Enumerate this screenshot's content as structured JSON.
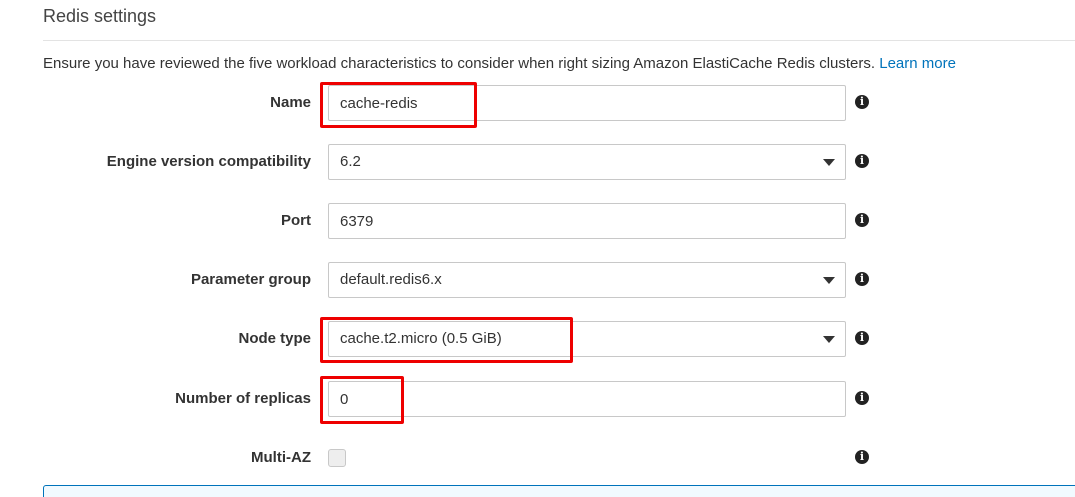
{
  "section": {
    "title": "Redis settings",
    "intro": "Ensure you have reviewed the five workload characteristics to consider when right sizing Amazon ElastiCache Redis clusters.",
    "learn_more": "Learn more"
  },
  "fields": {
    "name": {
      "label": "Name",
      "value": "cache-redis"
    },
    "engine_version": {
      "label": "Engine version compatibility",
      "value": "6.2"
    },
    "port": {
      "label": "Port",
      "value": "6379"
    },
    "parameter_group": {
      "label": "Parameter group",
      "value": "default.redis6.x"
    },
    "node_type": {
      "label": "Node type",
      "value": "cache.t2.micro (0.5 GiB)"
    },
    "replicas": {
      "label": "Number of replicas",
      "value": "0"
    },
    "multi_az": {
      "label": "Multi-AZ",
      "checked": false
    }
  },
  "icons": {
    "info": "info-icon",
    "dropdown": "chevron-down-icon"
  },
  "colors": {
    "link": "#0073bb",
    "highlight": "#ee0000",
    "info_box_border": "#0073bb"
  }
}
